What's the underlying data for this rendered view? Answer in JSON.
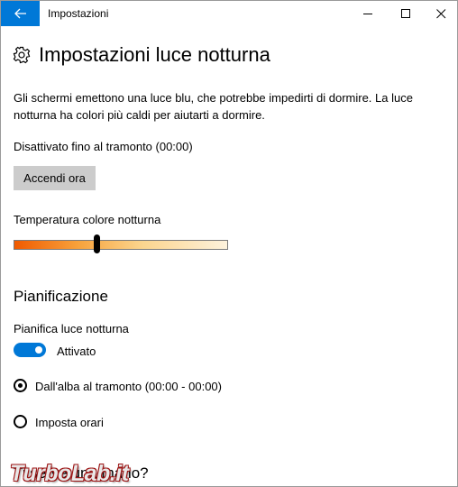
{
  "window": {
    "title": "Impostazioni",
    "accent_color": "#0078d7"
  },
  "icons": {
    "back": "arrow-left-icon",
    "settings": "gear-icon",
    "minimize": "minimize-icon",
    "maximize": "maximize-icon",
    "close": "close-icon"
  },
  "page": {
    "title": "Impostazioni luce notturna",
    "description": "Gli schermi emettono una luce blu, che potrebbe impedirti di dormire. La luce notturna ha colori più caldi per aiutarti a dormire.",
    "status": "Disattivato fino al tramonto (00:00)",
    "turn_on_button": "Accendi ora",
    "color_temperature": {
      "label": "Temperatura colore notturna",
      "value_fraction": 0.39
    }
  },
  "schedule": {
    "section_title": "Pianificazione",
    "toggle_label": "Pianifica luce notturna",
    "toggle_state": "Attivato",
    "toggle_on": true,
    "options": [
      {
        "label": "Dall'alba al tramonto (00:00 - 00:00)",
        "selected": true
      },
      {
        "label": "Imposta orari",
        "selected": false
      }
    ],
    "next_section_partial": "Ti serve una mano?"
  },
  "watermark": {
    "text": "TurboLab.it"
  }
}
